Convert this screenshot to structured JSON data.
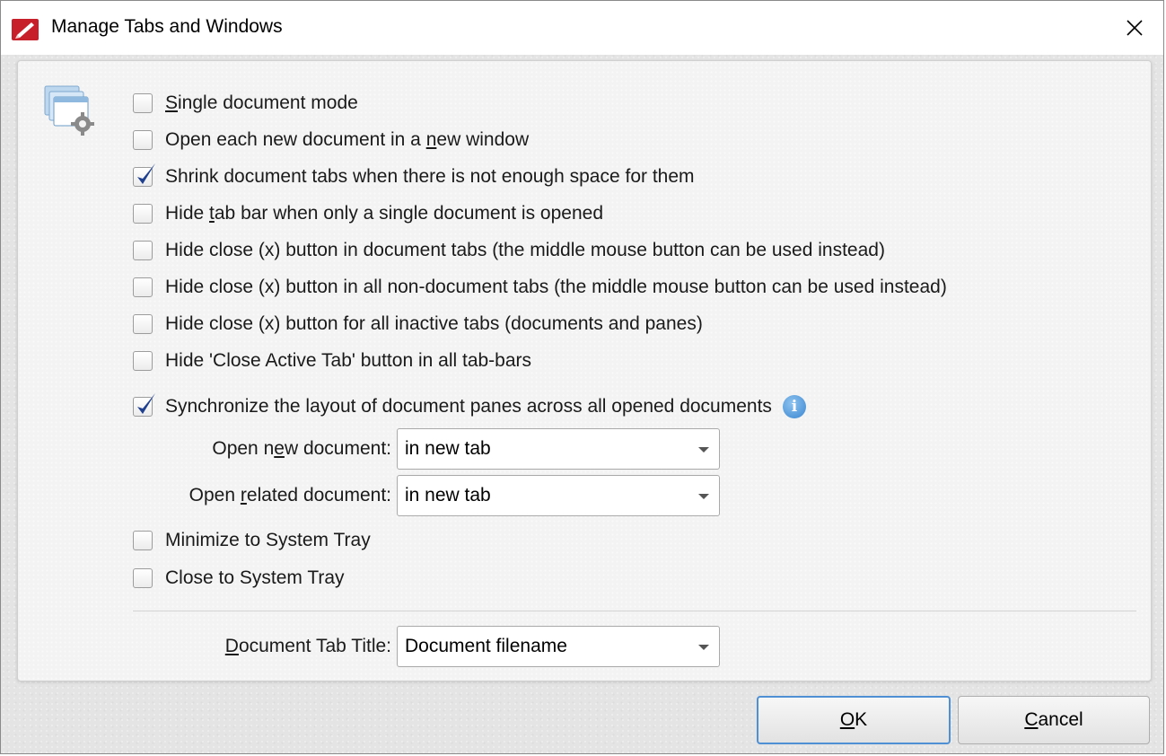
{
  "window": {
    "title": "Manage Tabs and Windows"
  },
  "options": [
    {
      "label": "Single document mode",
      "checked": false
    },
    {
      "label": "Open each new document in a new window",
      "checked": false
    },
    {
      "label": "Shrink document tabs when there is not enough space for them",
      "checked": true
    },
    {
      "label": "Hide tab bar when only a single document is opened",
      "checked": false
    },
    {
      "label": "Hide close (x) button in document tabs (the middle mouse button can be used instead)",
      "checked": false
    },
    {
      "label": "Hide close (x) button in all non-document tabs (the middle mouse button can be used instead)",
      "checked": false
    },
    {
      "label": "Hide close (x) button for all inactive tabs (documents and panes)",
      "checked": false
    },
    {
      "label": "Hide 'Close Active Tab' button in all tab-bars",
      "checked": false
    },
    {
      "label": "Synchronize the layout of document panes across all opened documents",
      "checked": true
    },
    {
      "label": "Minimize to System Tray",
      "checked": false
    },
    {
      "label": "Close to System Tray",
      "checked": false
    }
  ],
  "open_new_document": {
    "label": "Open new document:",
    "value": "in new tab"
  },
  "open_related_document": {
    "label": "Open related document:",
    "value": "in new tab"
  },
  "document_tab_title": {
    "label": "Document Tab Title:",
    "value": "Document filename"
  },
  "buttons": {
    "ok": "OK",
    "cancel": "Cancel"
  },
  "icons": {
    "app": "pdf-app-icon",
    "settings": "windows-settings-icon",
    "info": "info-icon",
    "close": "close-icon",
    "checkmark": "checkmark-icon",
    "dropdown": "chevron-down-icon"
  },
  "colors": {
    "accent": "#3a86d1",
    "check": "#1f3f8f",
    "app_icon": "#c8202a"
  }
}
